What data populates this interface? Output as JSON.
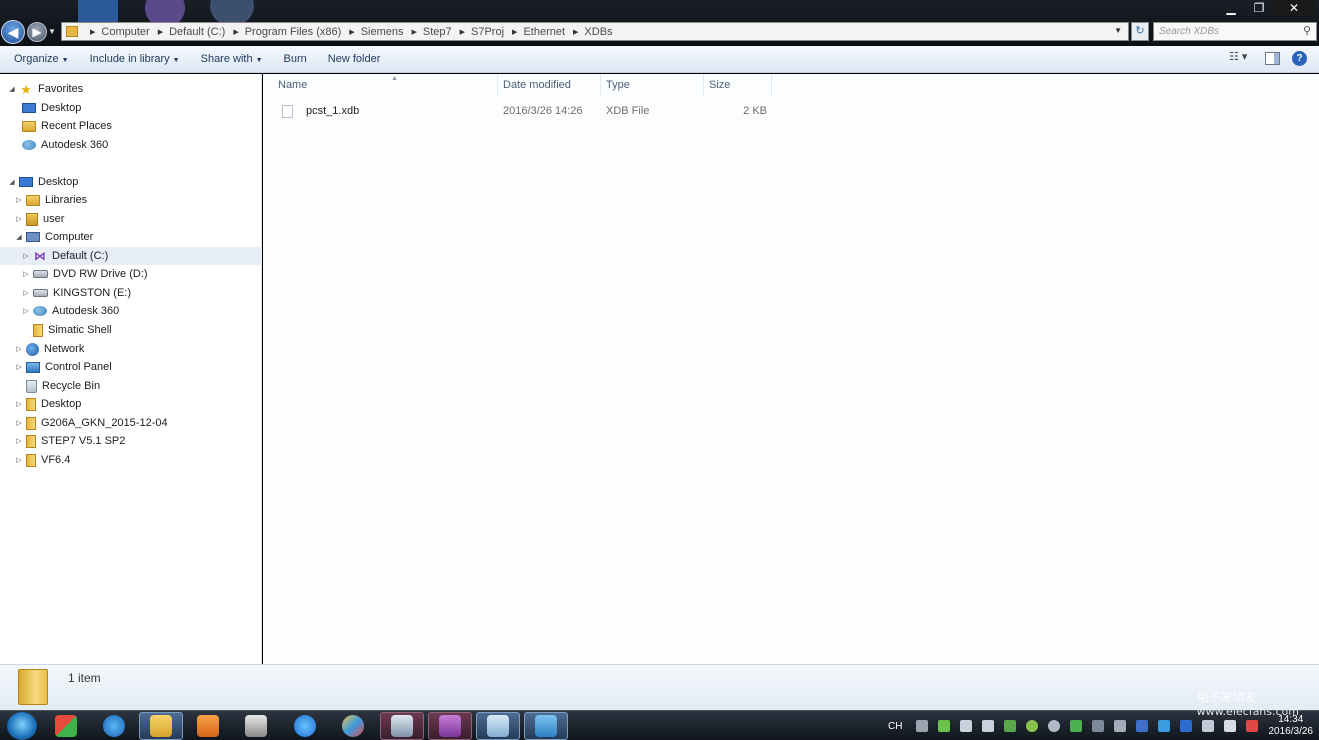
{
  "window": {
    "minimize_label": "▁",
    "maximize_label": "❐",
    "close_label": "✕"
  },
  "address_bar": {
    "segments": [
      "Computer",
      "Default (C:)",
      "Program Files (x86)",
      "Siemens",
      "Step7",
      "S7Proj",
      "Ethernet",
      "XDBs"
    ]
  },
  "search": {
    "placeholder": "Search XDBs"
  },
  "toolbar": {
    "organize": "Organize",
    "include_in_library": "Include in library",
    "share_with": "Share with",
    "burn": "Burn",
    "new_folder": "New folder"
  },
  "nav": {
    "favorites": "Favorites",
    "fav_items": [
      "Desktop",
      "Recent Places",
      "Autodesk 360"
    ],
    "desktop": "Desktop",
    "libraries": "Libraries",
    "user": "user",
    "computer": "Computer",
    "computer_items": [
      "Default (C:)",
      "DVD RW Drive (D:)",
      "KINGSTON (E:)",
      "Autodesk 360",
      "Simatic Shell"
    ],
    "other_items": [
      "Network",
      "Control Panel",
      "Recycle Bin",
      "Desktop",
      "G206A_GKN_2015-12-04",
      "STEP7 V5.1 SP2",
      "VF6.4"
    ]
  },
  "columns": {
    "name": "Name",
    "date_modified": "Date modified",
    "type": "Type",
    "size": "Size"
  },
  "files": [
    {
      "name": "pcst_1.xdb",
      "date_modified": "2016/3/26 14:26",
      "type": "XDB File",
      "size": "2 KB"
    }
  ],
  "details": {
    "count": "1 item"
  },
  "taskbar": {
    "language": "CH",
    "time": "14:34",
    "date": "2016/3/26"
  },
  "watermark": {
    "line1": "电子发烧友",
    "line2": "www.elecfans.com"
  }
}
